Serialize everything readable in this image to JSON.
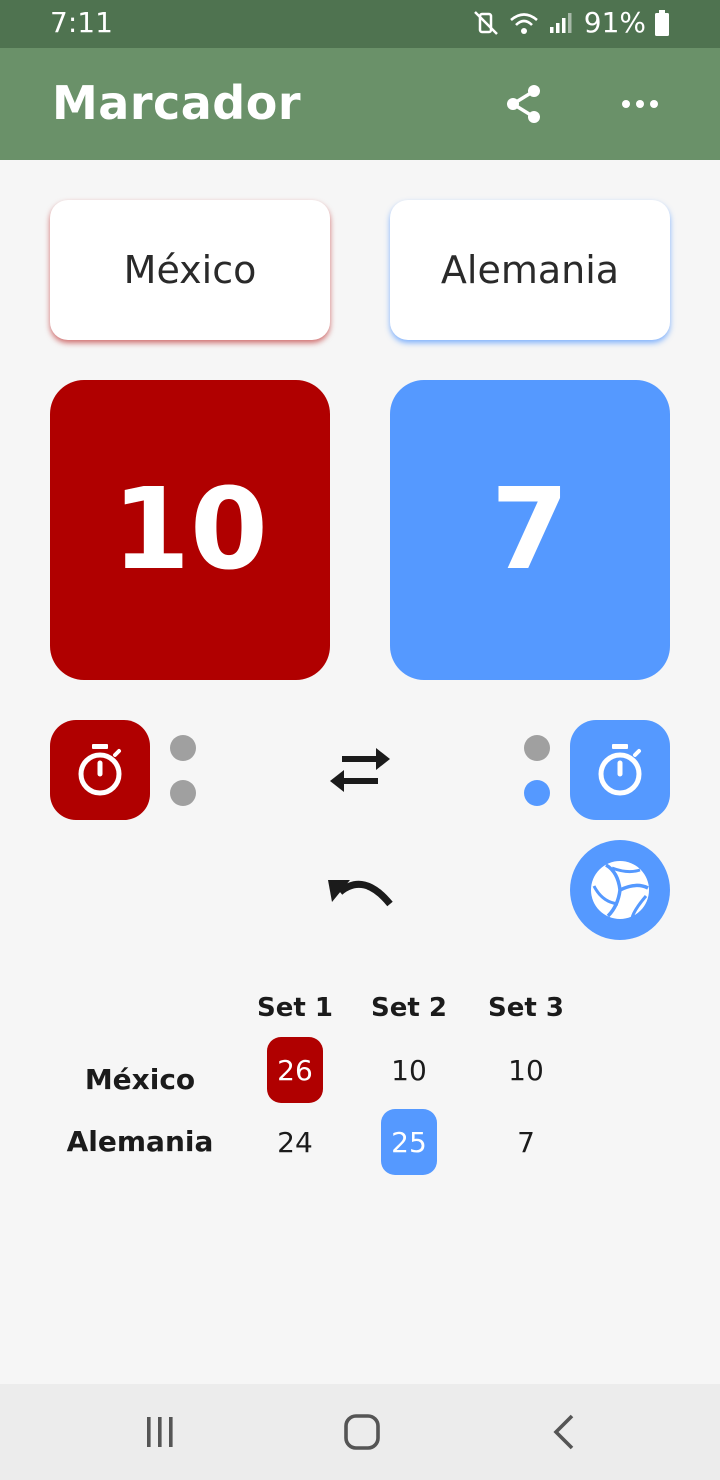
{
  "status_bar": {
    "time": "7:11",
    "battery": "91%",
    "icons": [
      "mute-vibrate-icon",
      "wifi-icon",
      "signal-icon",
      "battery-icon"
    ]
  },
  "app_bar": {
    "title": "Marcador",
    "icons": [
      "share-icon",
      "more-icon"
    ]
  },
  "teams": {
    "left": {
      "name": "México",
      "score": "10",
      "color": "#b00000"
    },
    "right": {
      "name": "Alemania",
      "score": "7",
      "color": "#5599ff"
    }
  },
  "controls": {
    "left_timer_icon": "stopwatch-icon",
    "right_timer_icon": "stopwatch-icon",
    "left_timeouts_used": 0,
    "right_timeouts_used": 1,
    "swap_icon": "swap-icon",
    "undo_icon": "undo-icon",
    "serve_icon": "volleyball-icon",
    "serving_team": "right"
  },
  "sets": {
    "headers": [
      "Set 1",
      "Set 2",
      "Set 3"
    ],
    "rows": [
      {
        "team": "México",
        "scores": [
          "26",
          "10",
          "10"
        ]
      },
      {
        "team": "Alemania",
        "scores": [
          "24",
          "25",
          "7"
        ]
      }
    ]
  },
  "nav_bar": {
    "icons": [
      "recent-apps-icon",
      "home-icon",
      "back-icon"
    ]
  },
  "colors": {
    "app_bar": "#6a9169",
    "status_bar": "#4f7350",
    "team_red": "#b00000",
    "team_blue": "#5599ff",
    "inactive_dot": "#a0a0a0"
  }
}
